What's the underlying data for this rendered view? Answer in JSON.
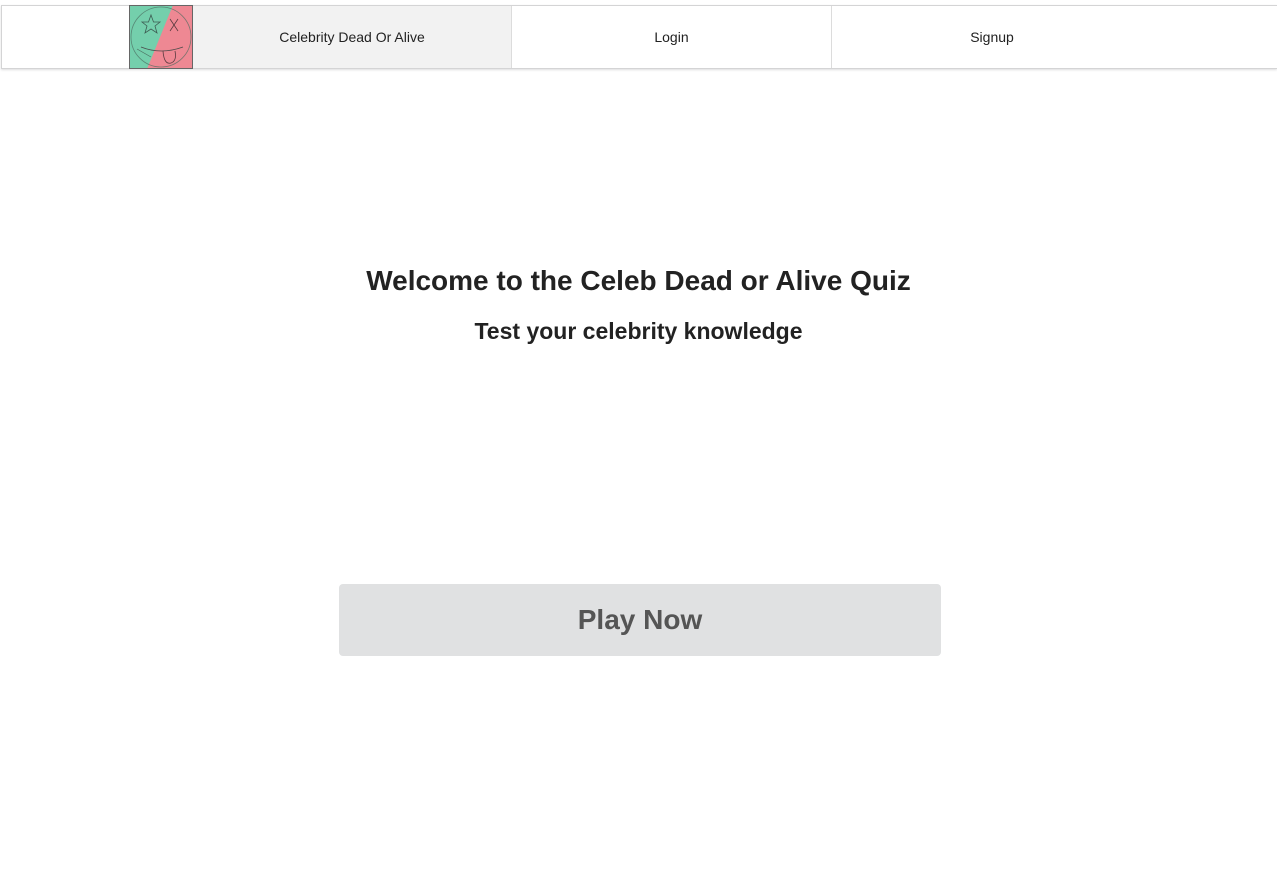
{
  "nav": {
    "brand_label": "Celebrity Dead Or Alive",
    "logo_icon": "dead-alive-face-icon",
    "items": [
      {
        "label": "Login"
      },
      {
        "label": "Signup"
      }
    ]
  },
  "hero": {
    "title": "Welcome to the Celeb Dead or Alive Quiz",
    "subtitle": "Test your celebrity knowledge"
  },
  "cta": {
    "label": "Play Now"
  },
  "colors": {
    "logo_alive": "#74cfac",
    "logo_dead": "#ee8893",
    "brand_bg": "#f2f2f2",
    "button_bg": "#e0e1e2",
    "button_text": "#555555"
  }
}
